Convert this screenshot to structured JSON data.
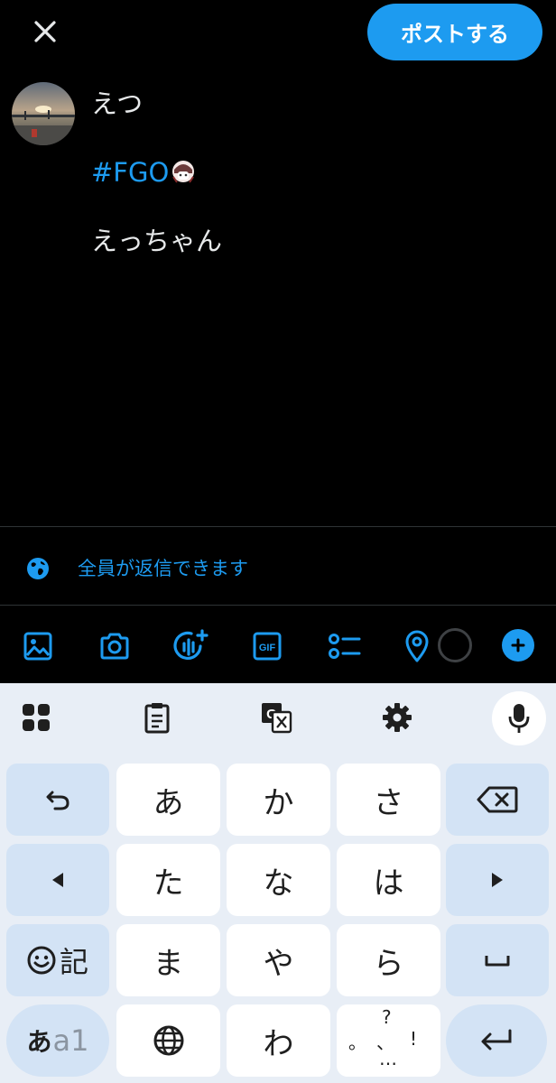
{
  "header": {
    "close_icon": "close-icon",
    "post_label": "ポストする"
  },
  "tweet": {
    "line1": "えつ",
    "hashtag": "#FGO",
    "line3": "えっちゃん"
  },
  "reply_setting": {
    "label": "全員が返信できます",
    "icon": "globe-icon"
  },
  "toolbar": {
    "icons": [
      "image-icon",
      "camera-icon",
      "gif-icon",
      "audio-spaces-icon",
      "poll-icon",
      "location-icon",
      "progress-ring",
      "add-icon"
    ],
    "gif_label": "GIF"
  },
  "keyboard": {
    "top_icons": [
      "apps-grid-icon",
      "clipboard-icon",
      "translate-icon",
      "settings-gear-icon",
      "microphone-icon"
    ],
    "rows": [
      [
        "あ",
        "か",
        "さ"
      ],
      [
        "た",
        "な",
        "は"
      ],
      [
        "ま",
        "や",
        "ら"
      ],
      [
        "わ"
      ]
    ],
    "emoji_label": "記",
    "mode_label_big": "あ",
    "mode_label_small": "a1",
    "punct": {
      "q": "?",
      "dot": "。",
      "comma": "、",
      "bang": "!",
      "ellipsis": "…"
    }
  },
  "colors": {
    "accent": "#1d9bf0",
    "background": "#000000",
    "text": "#e7e9ea",
    "keyboard_bg": "#e8eef6",
    "key_fn": "#d3e3f5"
  }
}
